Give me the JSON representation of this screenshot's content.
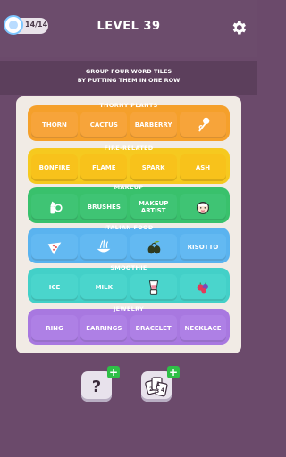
{
  "header": {
    "progress": "14/14",
    "level": "LEVEL 39"
  },
  "instructions": {
    "line1": "GROUP FOUR WORD TILES",
    "line2": "BY PUTTING THEM IN ONE ROW"
  },
  "rows": [
    {
      "label": "THORNY PLANTS",
      "color": "#f5a02b",
      "tileColor": "#f7a43a",
      "tiles": [
        "THORN",
        "CACTUS",
        "BARBERRY",
        "rose-icon"
      ]
    },
    {
      "label": "FIRE-RELATED",
      "color": "#f6c91f",
      "tileColor": "#f8c21b",
      "tiles": [
        "BONFIRE",
        "FLAME",
        "SPARK",
        "ASH"
      ]
    },
    {
      "label": "MAKEUP",
      "color": "#39c16c",
      "tileColor": "#3fc474",
      "tiles": [
        "lipstick-icon",
        "BRUSHES",
        "MAKEUP ARTIST",
        "face-icon"
      ]
    },
    {
      "label": "ITALIAN FOOD",
      "color": "#5ab3ef",
      "tileColor": "#63b9f2",
      "tiles": [
        "pizza-icon",
        "pasta-icon",
        "olive-icon",
        "RISOTTO"
      ]
    },
    {
      "label": "SMOOTHIE",
      "color": "#43d0c8",
      "tileColor": "#4ad5cc",
      "tiles": [
        "ICE",
        "MILK",
        "blender-icon",
        "berries-icon"
      ]
    },
    {
      "label": "JEWELRY",
      "color": "#a878e0",
      "tileColor": "#ae80e5",
      "tiles": [
        "RING",
        "EARRINGS",
        "BRACELET",
        "NECKLACE"
      ]
    }
  ],
  "powerups": {
    "hint": "?",
    "shuffle_cards": [
      "1",
      "2",
      "3",
      "4"
    ]
  }
}
